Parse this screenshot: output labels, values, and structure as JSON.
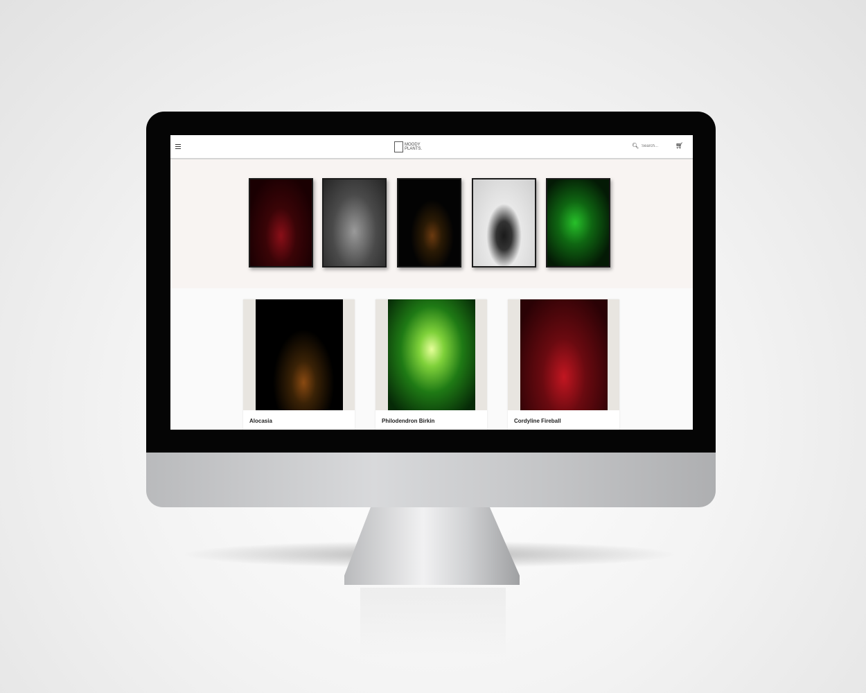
{
  "header": {
    "menu_icon": "hamburger-icon",
    "logo_text_line1": "MOODY",
    "logo_text_line2": "PLANTS.",
    "search_placeholder": "Search...",
    "search_icon": "search-icon",
    "cart_icon": "cart-icon"
  },
  "hero": {
    "frames": [
      {
        "name": "red-cordyline"
      },
      {
        "name": "grey-cactus"
      },
      {
        "name": "alocasia"
      },
      {
        "name": "euphorbia-bw"
      },
      {
        "name": "green-palm"
      }
    ]
  },
  "products": [
    {
      "title": "Alocasia"
    },
    {
      "title": "Philodendron Birkin"
    },
    {
      "title": "Cordyline Fireball"
    }
  ]
}
